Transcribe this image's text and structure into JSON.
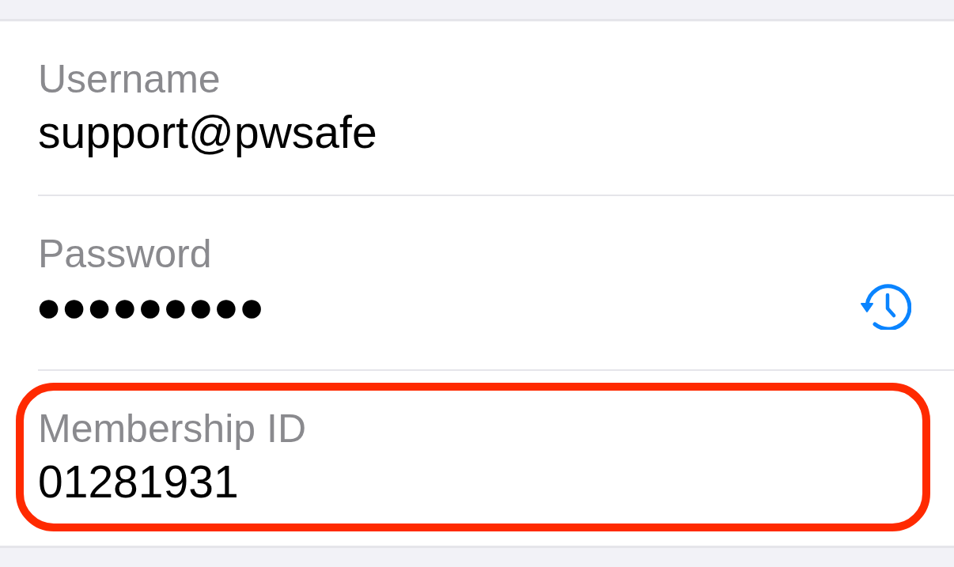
{
  "fields": [
    {
      "kind": "text",
      "label": "Username",
      "value": "support@pwsafe",
      "highlighted": false
    },
    {
      "kind": "password",
      "label": "Password",
      "value": "●●●●●●●●●",
      "highlighted": false
    },
    {
      "kind": "text",
      "label": "Membership ID",
      "value": "01281931",
      "highlighted": true
    }
  ]
}
